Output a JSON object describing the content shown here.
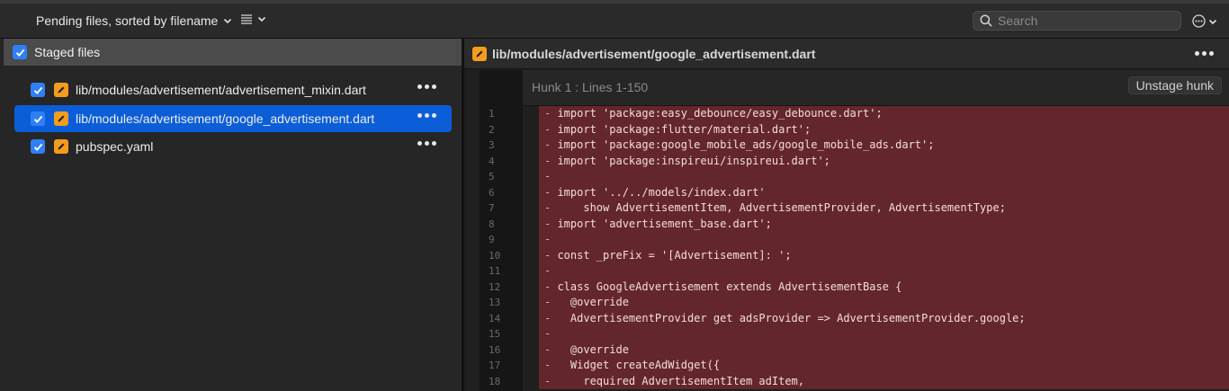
{
  "toolbar": {
    "sort_label": "Pending files, sorted by filename",
    "search_placeholder": "Search"
  },
  "staged": {
    "header_label": "Staged files",
    "files": [
      {
        "name": "lib/modules/advertisement/advertisement_mixin.dart",
        "selected": false
      },
      {
        "name": "lib/modules/advertisement/google_advertisement.dart",
        "selected": true
      },
      {
        "name": "pubspec.yaml",
        "selected": false
      }
    ]
  },
  "diff": {
    "file_path": "lib/modules/advertisement/google_advertisement.dart",
    "hunk_title": "Hunk 1 : Lines 1-150",
    "unstage_label": "Unstage hunk",
    "lines": [
      {
        "n": "1",
        "text": "import 'package:easy_debounce/easy_debounce.dart';"
      },
      {
        "n": "2",
        "text": "import 'package:flutter/material.dart';"
      },
      {
        "n": "3",
        "text": "import 'package:google_mobile_ads/google_mobile_ads.dart';"
      },
      {
        "n": "4",
        "text": "import 'package:inspireui/inspireui.dart';"
      },
      {
        "n": "5",
        "text": ""
      },
      {
        "n": "6",
        "text": "import '../../models/index.dart'"
      },
      {
        "n": "7",
        "text": "    show AdvertisementItem, AdvertisementProvider, AdvertisementType;"
      },
      {
        "n": "8",
        "text": "import 'advertisement_base.dart';"
      },
      {
        "n": "9",
        "text": ""
      },
      {
        "n": "10",
        "text": "const _preFix = '[Advertisement]: ';"
      },
      {
        "n": "11",
        "text": ""
      },
      {
        "n": "12",
        "text": "class GoogleAdvertisement extends AdvertisementBase {"
      },
      {
        "n": "13",
        "text": "  @override"
      },
      {
        "n": "14",
        "text": "  AdvertisementProvider get adsProvider => AdvertisementProvider.google;"
      },
      {
        "n": "15",
        "text": ""
      },
      {
        "n": "16",
        "text": "  @override"
      },
      {
        "n": "17",
        "text": "  Widget createAdWidget({"
      },
      {
        "n": "18",
        "text": "    required AdvertisementItem adItem,"
      }
    ]
  },
  "colors": {
    "accent": "#0b5ed7",
    "checkbox": "#2f7ff6",
    "modified_badge": "#f39c1e",
    "removed_line_bg": "#64262d"
  }
}
